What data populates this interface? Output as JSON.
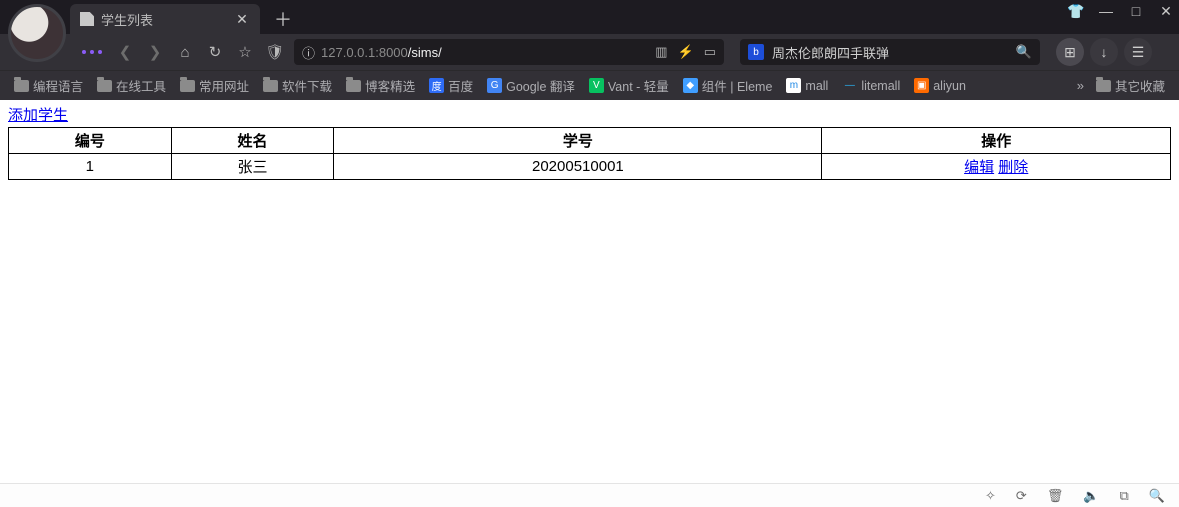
{
  "browser": {
    "tab_title": "学生列表",
    "window_controls": {
      "shirt": "👕",
      "min": "—",
      "max": "□",
      "close": "✕"
    }
  },
  "nav": {
    "back": "❮",
    "forward": "❯",
    "home": "⌂",
    "reload": "↻",
    "star": "☆",
    "shield": "🛡",
    "url_display_host": "127.0.0.1",
    "url_display_port": ":8000",
    "url_display_path": "/sims/",
    "qr": "▥",
    "flash": "⚡",
    "reader": "▭",
    "search_value": "周杰伦郎朗四手联弹",
    "search_icon": "🔍",
    "grid": "⊞",
    "download": "↓",
    "menu": "☰"
  },
  "bookmarks": {
    "items": [
      {
        "label": "编程语言",
        "type": "folder"
      },
      {
        "label": "在线工具",
        "type": "folder"
      },
      {
        "label": "常用网址",
        "type": "folder"
      },
      {
        "label": "软件下载",
        "type": "folder"
      },
      {
        "label": "博客精选",
        "type": "folder"
      },
      {
        "label": "百度",
        "type": "fav",
        "bg": "#2e6cf6",
        "glyph": "度"
      },
      {
        "label": "Google 翻译",
        "type": "fav",
        "bg": "#4285f4",
        "glyph": "G"
      },
      {
        "label": "Vant - 轻量",
        "type": "fav",
        "bg": "#07c160",
        "glyph": "V"
      },
      {
        "label": "组件 | Eleme",
        "type": "fav",
        "bg": "#409eff",
        "glyph": "◆"
      },
      {
        "label": "mall",
        "type": "fav",
        "bg": "#ffffff",
        "glyph": "m",
        "fg": "#1e88e5"
      },
      {
        "label": "litemall",
        "type": "fav",
        "bg": "#323036",
        "glyph": "—",
        "fg": "#29b6f6"
      },
      {
        "label": "aliyun",
        "type": "fav",
        "bg": "#ff6a00",
        "glyph": "▣"
      }
    ],
    "overflow": "»",
    "tail_label": "其它收藏"
  },
  "page": {
    "add_link": "添加学生",
    "headers": {
      "id": "编号",
      "name": "姓名",
      "stno": "学号",
      "ops": "操作"
    },
    "rows": [
      {
        "id": "1",
        "name": "张三",
        "stno": "20200510001",
        "edit": "编辑",
        "del": "删除"
      }
    ]
  },
  "status": {
    "i1": "✧",
    "i2": "⟳",
    "i3": "🗑",
    "i4": "🔈",
    "i5": "⧉",
    "i6": "🔍"
  }
}
